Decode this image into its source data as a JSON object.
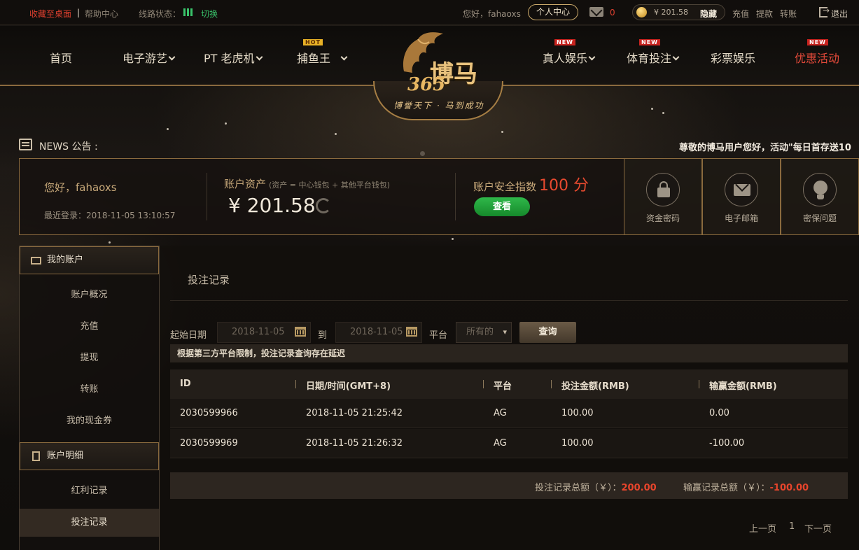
{
  "topbar": {
    "favorite": "收藏至桌面",
    "separator": "|",
    "help": "帮助中心",
    "line_status": "线路状态：",
    "switch": "切换",
    "greeting": "您好，fahaoxs",
    "personal_center": "个人中心",
    "mail_count": "0",
    "balance": "¥ 201.58",
    "hide": "隐藏",
    "deposit": "充值",
    "withdraw": "提款",
    "transfer": "转账",
    "logout": "退出"
  },
  "nav": {
    "items": [
      {
        "label": "首页"
      },
      {
        "label": "电子游艺"
      },
      {
        "label": "PT 老虎机"
      },
      {
        "label": "捕鱼王",
        "badge": "HOT"
      },
      {
        "label": "真人娱乐",
        "badge": "NEW"
      },
      {
        "label": "体育投注",
        "badge": "NEW"
      },
      {
        "label": "彩票娱乐"
      },
      {
        "label": "优惠活动",
        "badge": "NEW"
      }
    ],
    "colors": {
      "accent_red": "#e64a3a",
      "gold": "#8a6a3e"
    }
  },
  "logo": {
    "name": "博马",
    "number": "365",
    "slogan": "博誉天下 · 马到成功"
  },
  "news": {
    "label": "NEWS 公告 :",
    "marquee": "尊敬的博马用户您好，活动\"每日首存送10"
  },
  "account": {
    "hello": "您好，fahaoxs",
    "last_login": "最近登录：2018-11-05 13:10:57",
    "assets_label": "账户资产",
    "assets_note": "(资产 = 中心钱包 + 其他平台钱包)",
    "amount": "¥ 201.58",
    "security_label": "账户安全指数",
    "security_score": "100 分",
    "view_button": "查看",
    "security_items": [
      {
        "icon": "lock-icon",
        "label": "资金密码"
      },
      {
        "icon": "mail-icon",
        "label": "电子邮箱"
      },
      {
        "icon": "bulb-icon",
        "label": "密保问题"
      }
    ]
  },
  "sidebar": {
    "section1": "我的账户",
    "items1": [
      "账户概况",
      "充值",
      "提现",
      "转账",
      "我的现金券"
    ],
    "section2": "账户明细",
    "items2": [
      "红利记录",
      "投注记录"
    ],
    "active": "投注记录"
  },
  "main": {
    "title": "投注记录",
    "filter": {
      "start_label": "起始日期",
      "start_value": "2018-11-05",
      "to_label": "到",
      "end_value": "2018-11-05",
      "platform_label": "平台",
      "platform_value": "所有的",
      "query_button": "查询"
    },
    "notice": "根据第三方平台限制，投注记录查询存在延迟",
    "table": {
      "headers": [
        "ID",
        "日期/时间(GMT+8)",
        "平台",
        "投注金额(RMB)",
        "输赢金额(RMB)"
      ],
      "rows": [
        [
          "2030599966",
          "2018-11-05 21:25:42",
          "AG",
          "100.00",
          "0.00"
        ],
        [
          "2030599969",
          "2018-11-05 21:26:32",
          "AG",
          "100.00",
          "-100.00"
        ]
      ]
    },
    "totals": {
      "bet_label": "投注记录总额（￥）：",
      "bet_value": "200.00",
      "win_label": "输赢记录总额（￥）：",
      "win_value": "-100.00"
    },
    "pager": {
      "prev": "上一页",
      "page": "1",
      "next": "下一页"
    }
  }
}
